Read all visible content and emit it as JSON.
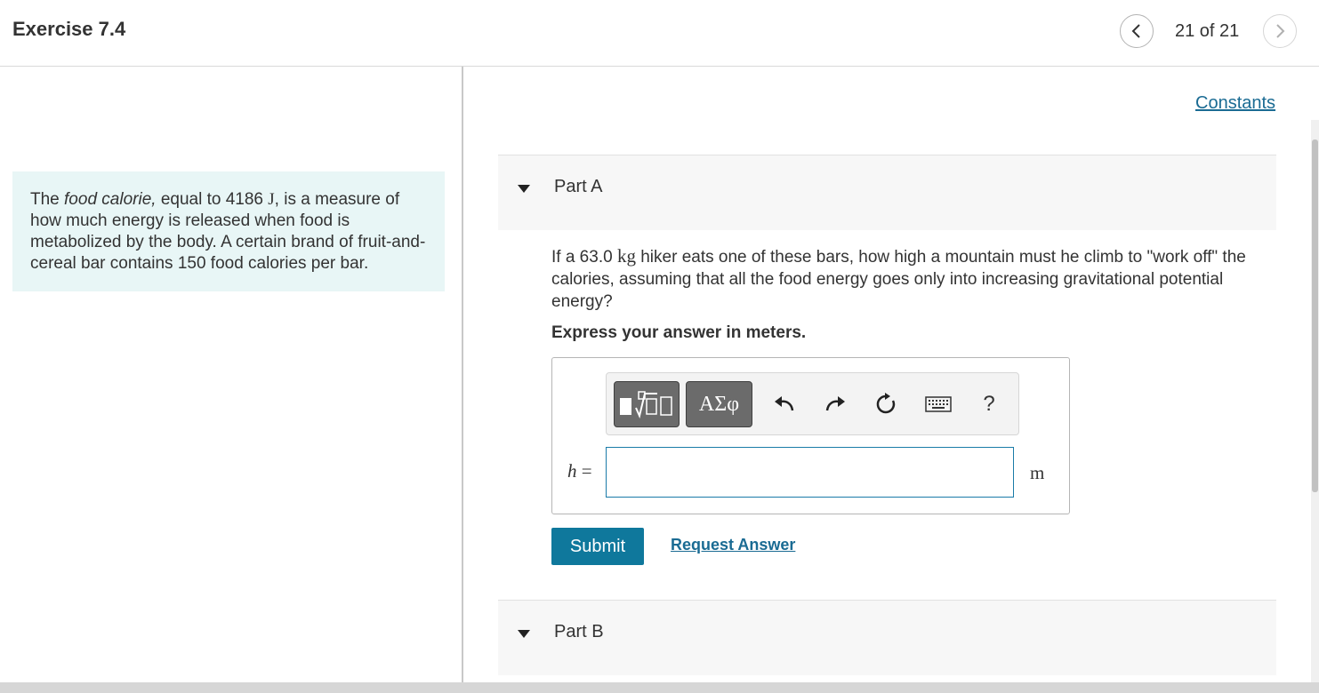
{
  "header": {
    "title": "Exercise 7.4",
    "page_indicator": "21 of 21"
  },
  "scenario": {
    "text_1": "The ",
    "emphasis": "food calorie,",
    "text_2": " equal to 4186 ",
    "unit": "J",
    "text_3": ", is a measure of how much energy is released when food is metabolized by the body. A certain brand of fruit-and-cereal bar contains 150 food calories per bar."
  },
  "constants_link": "Constants",
  "part_a": {
    "title": "Part A",
    "question_1": "If a 63.0 ",
    "question_unit": "kg",
    "question_2": " hiker eats one of these bars, how high a mountain must he climb to \"work off\" the calories, assuming that all the food energy goes only into increasing gravitational potential energy?",
    "instruction": "Express your answer in meters.",
    "toolbar": {
      "symbols_label": "ΑΣφ",
      "help_label": "?",
      "icons": [
        "templates-icon",
        "undo-icon",
        "redo-icon",
        "reset-icon",
        "keyboard-icon"
      ]
    },
    "variable": "h",
    "equals": " =",
    "answer_value": "",
    "unit": "m",
    "submit_label": "Submit",
    "request_label": "Request Answer"
  },
  "part_b": {
    "title": "Part B"
  },
  "colors": {
    "accent": "#0f789c",
    "link": "#1a6b93",
    "scenario_bg": "#e8f6f6"
  }
}
